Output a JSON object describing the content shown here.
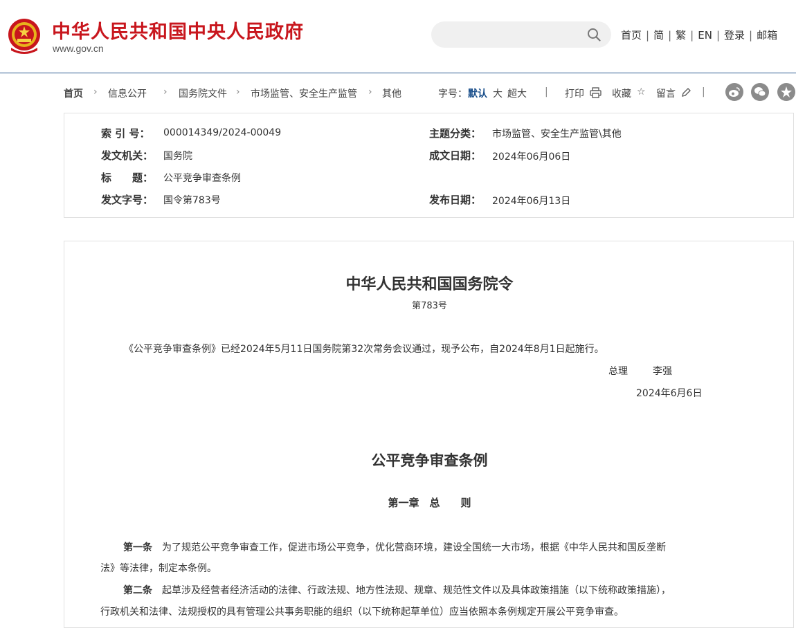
{
  "header": {
    "site_title": "中华人民共和国中央人民政府",
    "site_url": "www.gov.cn",
    "search_placeholder": "",
    "nav": [
      "首页",
      "简",
      "繁",
      "EN",
      "登录",
      "邮箱"
    ]
  },
  "breadcrumb": [
    "首页",
    "信息公开",
    "国务院文件",
    "市场监管、安全生产监管",
    "其他"
  ],
  "tools": {
    "font_label": "字号：",
    "font_default": "默认",
    "font_large": "大",
    "font_xlarge": "超大",
    "print": "打印",
    "favorite": "收藏",
    "comment": "留言"
  },
  "meta": {
    "index_label": "索 引 号：",
    "index_value": "000014349/2024-00049",
    "topic_label": "主题分类：",
    "topic_value": "市场监管、安全生产监管\\其他",
    "issuer_label": "发文机关：",
    "issuer_value": "国务院",
    "written_label": "成文日期：",
    "written_value": "2024年06月06日",
    "title_label": "标　　题：",
    "title_value": "公平竞争审查条例",
    "docno_label": "发文字号：",
    "docno_value": "国令第783号",
    "publish_label": "发布日期：",
    "publish_value": "2024年06月13日"
  },
  "article": {
    "order_title": "中华人民共和国国务院令",
    "order_no": "第783号",
    "announcement": "《公平竞争审查条例》已经2024年5月11日国务院第32次常务会议通过，现予公布，自2024年8月1日起施行。",
    "signer_title": "总理",
    "signer_name": "李强",
    "sign_date": "2024年6月6日",
    "regulation_title": "公平竞争审查条例",
    "chapter1": "第一章　总　　则",
    "art1_label": "第一条",
    "art1_line1": "为了规范公平竞争审查工作，促进市场公平竞争，优化营商环境，建设全国统一大市场，根据《中华人民共和国反垄断",
    "art1_line2": "法》等法律，制定本条例。",
    "art2_label": "第二条",
    "art2_line1": "起草涉及经营者经济活动的法律、行政法规、地方性法规、规章、规范性文件以及具体政策措施（以下统称政策措施），",
    "art2_line2": "行政机关和法律、法规授权的具有管理公共事务职能的组织（以下统称起草单位）应当依照本条例规定开展公平竞争审查。"
  },
  "colors": {
    "brand_red": "#c8161d",
    "link_blue": "#1a4f8b"
  }
}
